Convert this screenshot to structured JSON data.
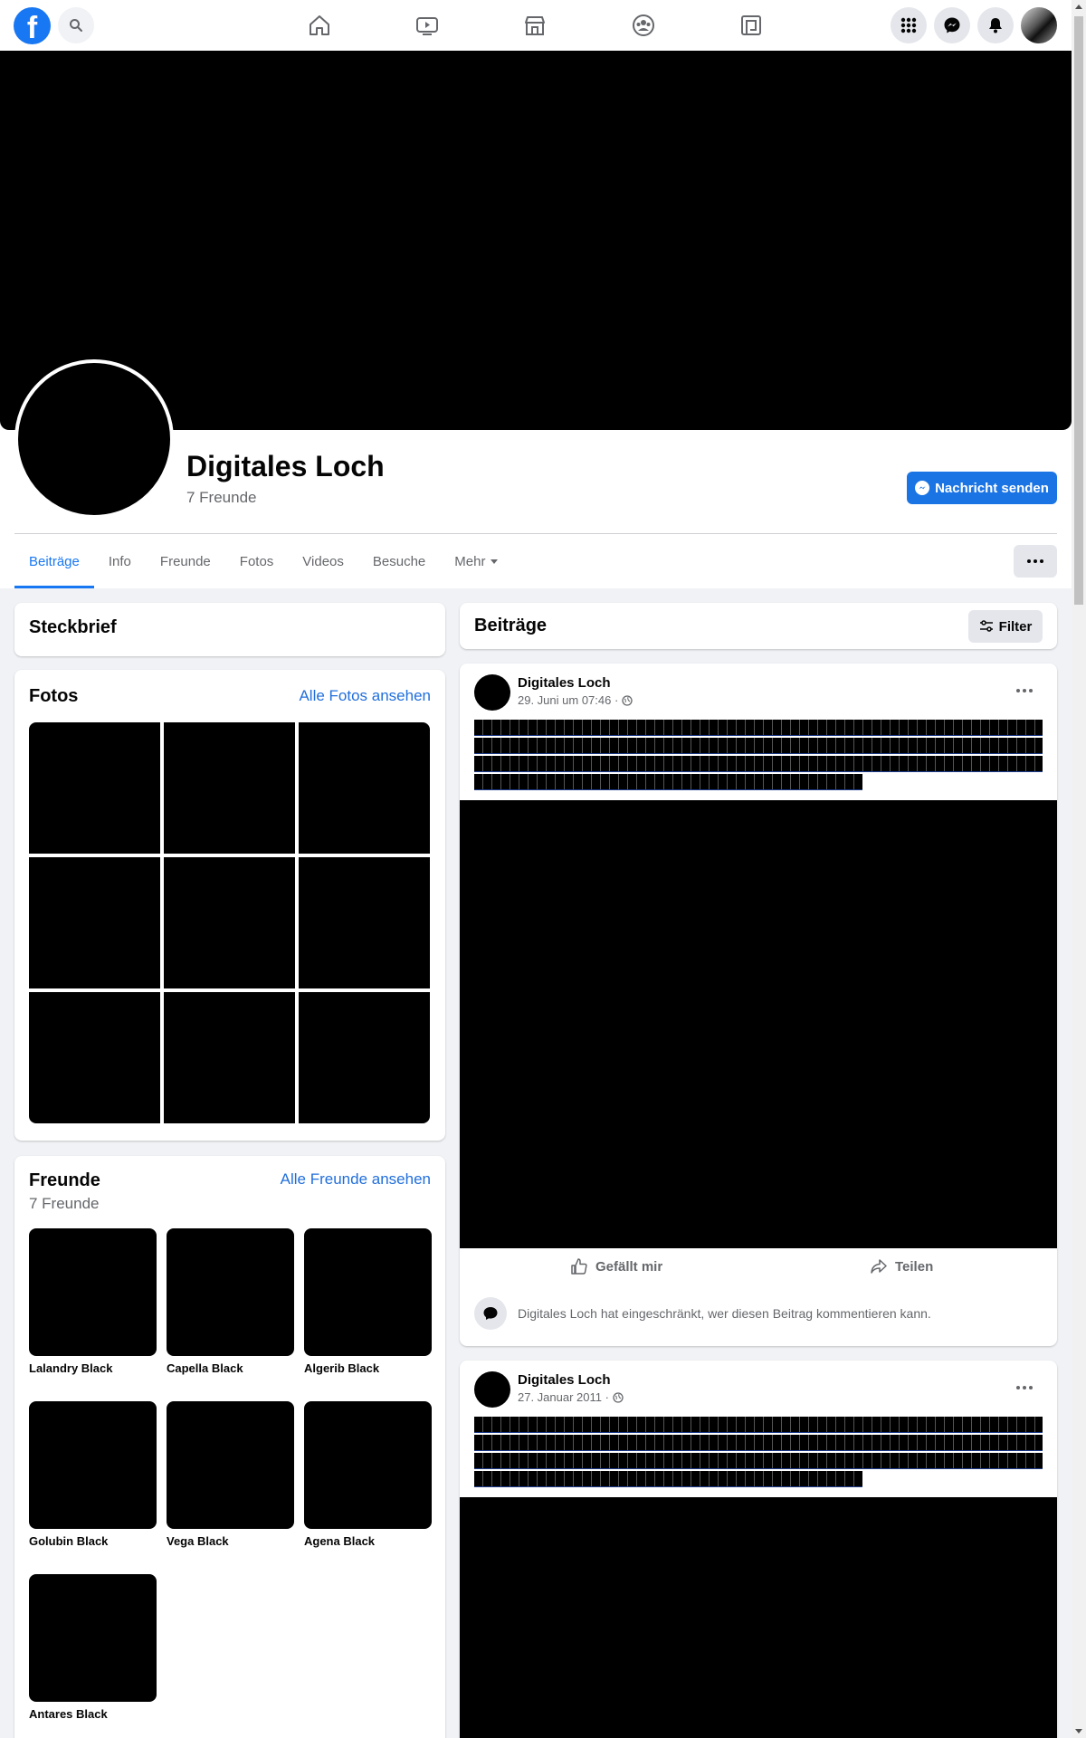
{
  "topnav": {
    "logo": "f",
    "icons": [
      "search-icon",
      "home-icon",
      "watch-icon",
      "marketplace-icon",
      "groups-icon",
      "gaming-icon",
      "menu-icon",
      "messenger-icon",
      "notifications-icon",
      "account-icon"
    ]
  },
  "profile": {
    "name": "Digitales Loch",
    "friend_count": "7 Freunde",
    "message_button": "Nachricht senden"
  },
  "tabs": [
    "Beiträge",
    "Info",
    "Freunde",
    "Fotos",
    "Videos",
    "Besuche",
    "Mehr"
  ],
  "intro": {
    "title": "Steckbrief"
  },
  "photos": {
    "title": "Fotos",
    "link": "Alle Fotos ansehen",
    "count_shown": 9
  },
  "friends": {
    "title": "Freunde",
    "subtitle": "7 Freunde",
    "link": "Alle Freunde ansehen",
    "items": [
      "Lalandry Black",
      "Capella Black",
      "Algerib Black",
      "Golubin Black",
      "Vega Black",
      "Agena Black",
      "Antares Black"
    ]
  },
  "posts_header": {
    "title": "Beiträge",
    "filter_label": "Filter"
  },
  "posts": [
    {
      "author": "Digitales Loch",
      "date": "29. Juni um 07:46 ·",
      "like_label": "Gefällt mir",
      "share_label": "Teilen",
      "restricted_text": "Digitales Loch hat eingeschränkt, wer diesen Beitrag kommentieren kann."
    },
    {
      "author": "Digitales Loch",
      "date": "27. Januar 2011 ·"
    }
  ],
  "colors": {
    "accent": "#1877f2",
    "button": "#1b74e4",
    "background": "#f0f2f5"
  }
}
